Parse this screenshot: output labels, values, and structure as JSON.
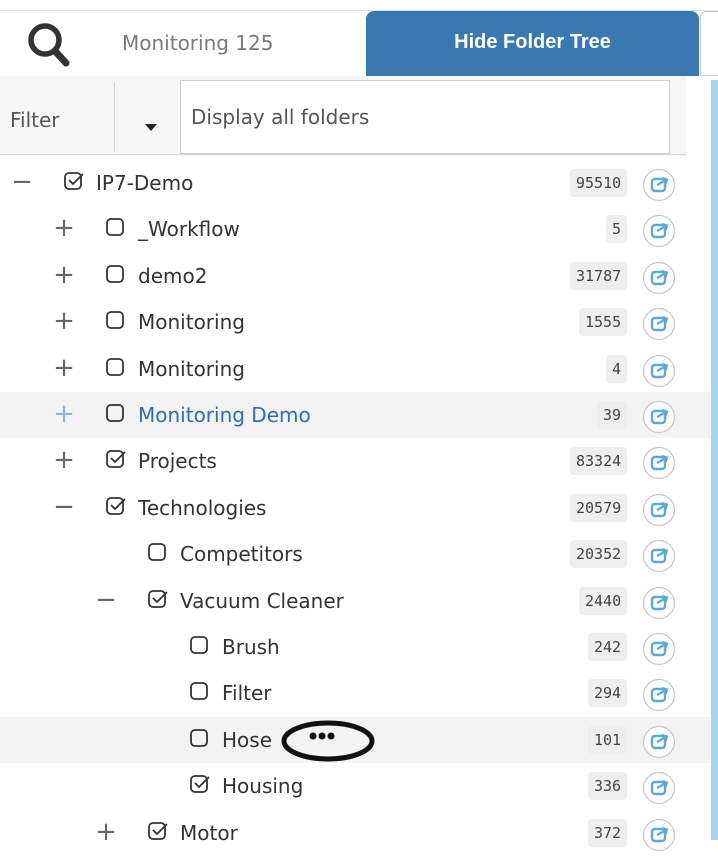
{
  "header": {
    "search_title": "Monitoring 125",
    "hide_tree_label": "Hide Folder Tree"
  },
  "filter": {
    "label": "Filter",
    "placeholder": "Display all folders"
  },
  "tree": {
    "rows": [
      {
        "label": "IP7-Demo",
        "count": "95510",
        "toggle": "−",
        "checked": true
      },
      {
        "label": "_Workflow",
        "count": "5",
        "toggle": "+",
        "checked": false
      },
      {
        "label": "demo2",
        "count": "31787",
        "toggle": "+",
        "checked": false
      },
      {
        "label": "Monitoring",
        "count": "1555",
        "toggle": "+",
        "checked": false
      },
      {
        "label": "Monitoring",
        "count": "4",
        "toggle": "+",
        "checked": false
      },
      {
        "label": "Monitoring Demo",
        "count": "39",
        "toggle": "+",
        "checked": false,
        "hovered": true
      },
      {
        "label": "Projects",
        "count": "83324",
        "toggle": "+",
        "checked": true
      },
      {
        "label": "Technologies",
        "count": "20579",
        "toggle": "−",
        "checked": true
      },
      {
        "label": "Competitors",
        "count": "20352",
        "toggle": "",
        "checked": false
      },
      {
        "label": "Vacuum Cleaner",
        "count": "2440",
        "toggle": "−",
        "checked": true
      },
      {
        "label": "Brush",
        "count": "242",
        "toggle": "",
        "checked": false
      },
      {
        "label": "Filter",
        "count": "294",
        "toggle": "",
        "checked": false
      },
      {
        "label": "Hose",
        "count": "101",
        "toggle": "",
        "checked": false,
        "hovered": true
      },
      {
        "label": "Housing",
        "count": "336",
        "toggle": "",
        "checked": true
      },
      {
        "label": "Motor",
        "count": "372",
        "toggle": "+",
        "checked": true
      }
    ]
  },
  "icons": {
    "search": "search-icon",
    "dropdown": "caret-down-icon",
    "checkbox": "checkbox-icon",
    "share": "share-icon",
    "more": "more-options-icon"
  },
  "colors": {
    "accent": "#3a78b2",
    "share_icon": "#5aa9dd",
    "hover_text": "#2a6fb6"
  }
}
